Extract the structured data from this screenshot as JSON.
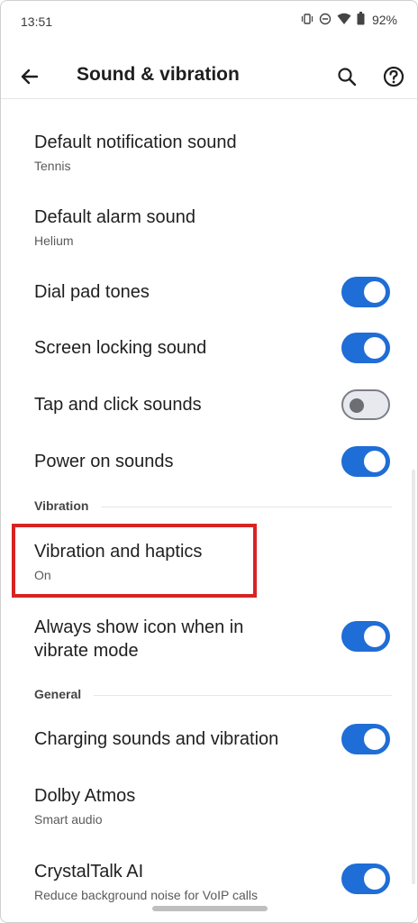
{
  "status": {
    "time": "13:51",
    "battery": "92%"
  },
  "appbar": {
    "title": "Sound & vibration"
  },
  "items": {
    "default_notification": {
      "label": "Default notification sound",
      "sub": "Tennis"
    },
    "default_alarm": {
      "label": "Default alarm sound",
      "sub": "Helium"
    },
    "dial_pad": {
      "label": "Dial pad tones",
      "on": true
    },
    "screen_lock": {
      "label": "Screen locking sound",
      "on": true
    },
    "tap_click": {
      "label": "Tap and click sounds",
      "on": false
    },
    "power_on": {
      "label": "Power on sounds",
      "on": true
    },
    "vibration_haptics": {
      "label": "Vibration and haptics",
      "sub": "On"
    },
    "always_show_icon": {
      "label_line1": "Always show icon when in",
      "label_line2": "vibrate mode",
      "on": true
    },
    "charging": {
      "label": "Charging sounds and vibration",
      "on": true
    },
    "dolby": {
      "label": "Dolby Atmos",
      "sub": "Smart audio"
    },
    "crystaltalk": {
      "label": "CrystalTalk AI",
      "sub": "Reduce background noise for VoIP calls",
      "on": true
    }
  },
  "sections": {
    "vibration": "Vibration",
    "general": "General"
  },
  "colors": {
    "accent": "#1f6dd6",
    "highlight": "#d62424"
  }
}
